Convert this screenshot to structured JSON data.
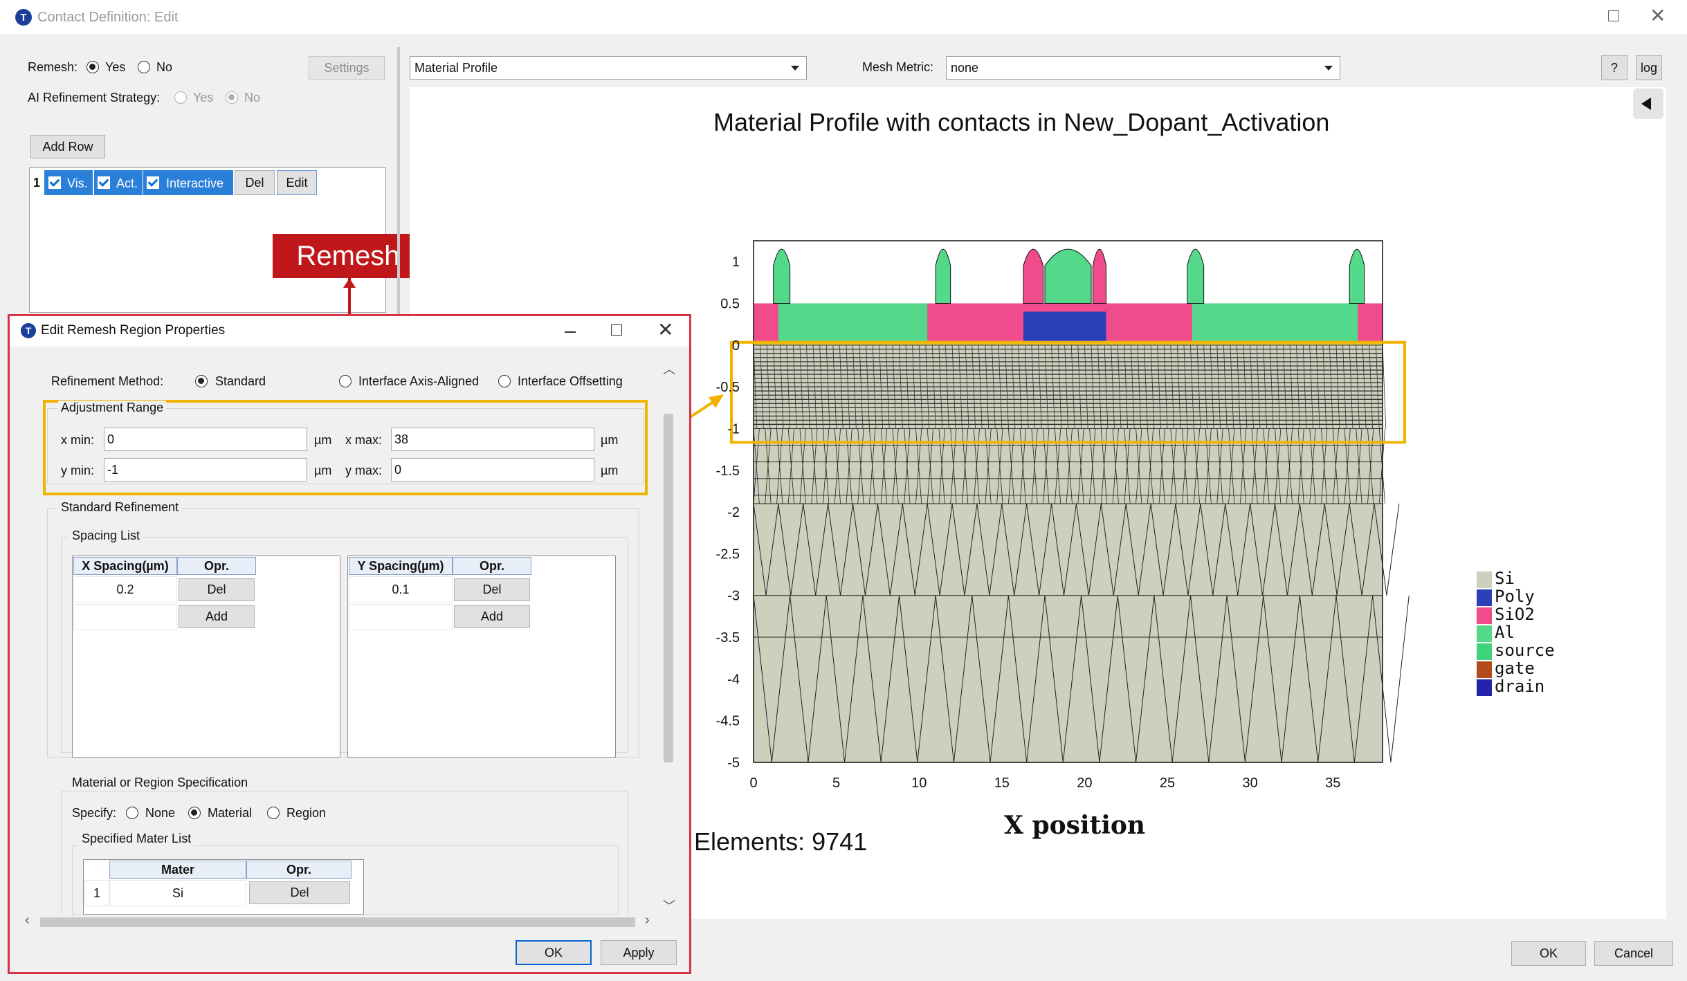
{
  "window": {
    "title": "Contact Definition: Edit",
    "app_icon": "T"
  },
  "left_panel": {
    "remesh_label": "Remesh:",
    "remesh_yes": "Yes",
    "remesh_no": "No",
    "remesh_selected": "Yes",
    "settings_button": "Settings",
    "ai_label": "AI Refinement Strategy:",
    "ai_yes": "Yes",
    "ai_no": "No",
    "add_row_button": "Add Row",
    "row": {
      "index": "1",
      "vis": "Vis.",
      "act": "Act.",
      "interactive": "Interactive",
      "del": "Del",
      "edit": "Edit"
    }
  },
  "annotation": {
    "remesh_tag": "Remesh",
    "tag_color": "#c0171b",
    "highlight_color": "#f0b400"
  },
  "toolbar": {
    "profile_combo": "Material Profile",
    "mesh_metric_label": "Mesh Metric:",
    "mesh_metric_value": "none",
    "help_button": "?",
    "log_button": "log",
    "collapse_icon": "triangle-left-icon"
  },
  "plot": {
    "title": "Material Profile with contacts in New_Dopant_Activation",
    "elements_text": "Elements: 9741",
    "xlabel": "X position"
  },
  "chart_data": {
    "type": "heatmap",
    "title": "Material Profile with contacts in New_Dopant_Activation",
    "xlabel": "X position",
    "ylabel": "",
    "xlim": [
      0,
      38
    ],
    "ylim": [
      -5,
      1.25
    ],
    "x_ticks": [
      "0",
      "5",
      "10",
      "15",
      "20",
      "25",
      "30",
      "35"
    ],
    "y_ticks": [
      "1",
      "0.5",
      "0",
      "-0.5",
      "-1",
      "-1.5",
      "-2",
      "-2.5",
      "-3",
      "-3.5",
      "-4",
      "-4.5",
      "-5"
    ],
    "legend": [
      {
        "name": "Si",
        "color": "#cfcfbe"
      },
      {
        "name": "Poly",
        "color": "#2a3fb8"
      },
      {
        "name": "SiO2",
        "color": "#f04c8c"
      },
      {
        "name": "Al",
        "color": "#54d98a"
      },
      {
        "name": "source",
        "color": "#3fd47a"
      },
      {
        "name": "gate",
        "color": "#b24a1a"
      },
      {
        "name": "drain",
        "color": "#2323a8"
      }
    ],
    "highlight_region": {
      "x": [
        0,
        38
      ],
      "y": [
        -1,
        0
      ]
    }
  },
  "dialog": {
    "title": "Edit Remesh Region Properties",
    "refinement_method_label": "Refinement Method:",
    "method_standard": "Standard",
    "method_axis": "Interface Axis-Aligned",
    "method_offset": "Interface Offsetting",
    "method_selected": "Standard",
    "adjustment_range": "Adjustment Range",
    "x_min_label": "x min:",
    "x_min": "0",
    "x_max_label": "x max:",
    "x_max": "38",
    "y_min_label": "y min:",
    "y_min": "-1",
    "y_max_label": "y max:",
    "y_max": "0",
    "unit": "µm",
    "standard_refinement": "Standard Refinement",
    "spacing_list": "Spacing List",
    "x_table": {
      "col1": "X Spacing(µm)",
      "col2": "Opr.",
      "value": "0.2",
      "del": "Del",
      "add": "Add"
    },
    "y_table": {
      "col1": "Y Spacing(µm)",
      "col2": "Opr.",
      "value": "0.1",
      "del": "Del",
      "add": "Add"
    },
    "material_spec": "Material or Region Specification",
    "specify_label": "Specify:",
    "spec_none": "None",
    "spec_material": "Material",
    "spec_region": "Region",
    "spec_selected": "Material",
    "specified_list": "Specified Mater List",
    "mat_table": {
      "col1": "Mater",
      "col2": "Opr.",
      "row_index": "1",
      "row_value": "Si",
      "del": "Del"
    },
    "ok": "OK",
    "apply": "Apply"
  },
  "footer": {
    "ok": "OK",
    "cancel": "Cancel"
  }
}
